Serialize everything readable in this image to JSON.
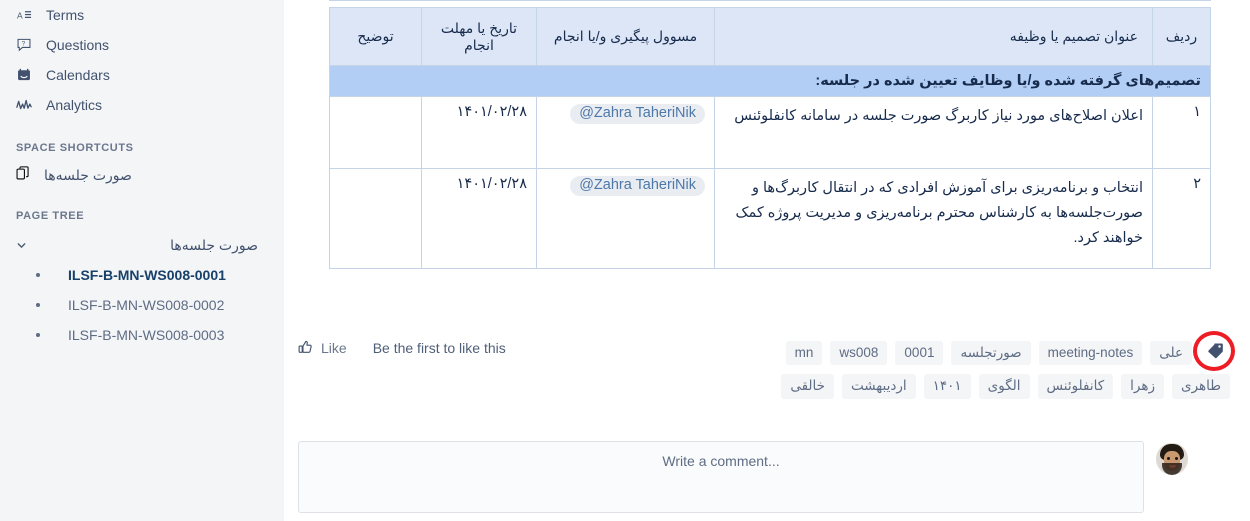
{
  "sidebar": {
    "nav_items": [
      {
        "label": "Terms",
        "icon": "terms-icon"
      },
      {
        "label": "Questions",
        "icon": "question-icon"
      },
      {
        "label": "Calendars",
        "icon": "calendar-icon"
      },
      {
        "label": "Analytics",
        "icon": "analytics-icon"
      }
    ],
    "space_shortcuts_heading": "SPACE SHORTCUTS",
    "shortcuts": [
      {
        "label": "صورت جلسه‌ها",
        "icon": "page-copy-icon"
      }
    ],
    "page_tree_heading": "PAGE TREE",
    "tree_root_label": "صورت جلسه‌ها",
    "tree_children": [
      {
        "label": "ILSF-B-MN-WS008-0001",
        "selected": true
      },
      {
        "label": "ILSF-B-MN-WS008-0002",
        "selected": false
      },
      {
        "label": "ILSF-B-MN-WS008-0003",
        "selected": false
      }
    ]
  },
  "table": {
    "banner_title": "تصمیم‌های گرفته شده و/یا وظایف تعیین شده در جلسه:",
    "headers": {
      "row_num": "ردیف",
      "title": "عنوان تصمیم یا وظیفه",
      "owner": "مسوول پیگیری و/یا انجام",
      "date": "تاریخ یا مهلت انجام",
      "note": "توضیح"
    },
    "rows": [
      {
        "num": "۱",
        "title": "اعلان اصلاح‌های مورد نیاز کاربرگ صورت جلسه در سامانه کانفلوئنس",
        "owner": "@Zahra TaheriNik",
        "date": "۱۴۰۱/۰۲/۲۸",
        "note": ""
      },
      {
        "num": "۲",
        "title": "انتخاب و برنامه‌ریزی برای آموزش افرادی که در انتقال کاربرگ‌ها و صورت‌جلسه‌ها به کارشناس محترم برنامه‌ریزی و مدیریت پروژه کمک خواهند کرد.",
        "owner": "@Zahra TaheriNik",
        "date": "۱۴۰۱/۰۲/۲۸",
        "note": ""
      }
    ]
  },
  "footer": {
    "like_label": "Like",
    "like_status": "Be the first to like this",
    "tag_icon": "tag-icon",
    "tags_row1": [
      "علی",
      "meeting-notes",
      "صورتجلسه",
      "0001",
      "ws008",
      "mn"
    ],
    "tags_row2": [
      "طاهری",
      "زهرا",
      "کانفلوئنس",
      "الگوی",
      "۱۴۰۱",
      "اردیبهشت",
      "خالقی"
    ],
    "highlight_color": "#ee1c25"
  },
  "comment": {
    "placeholder": "Write a comment...",
    "avatar_name": "user-avatar"
  }
}
